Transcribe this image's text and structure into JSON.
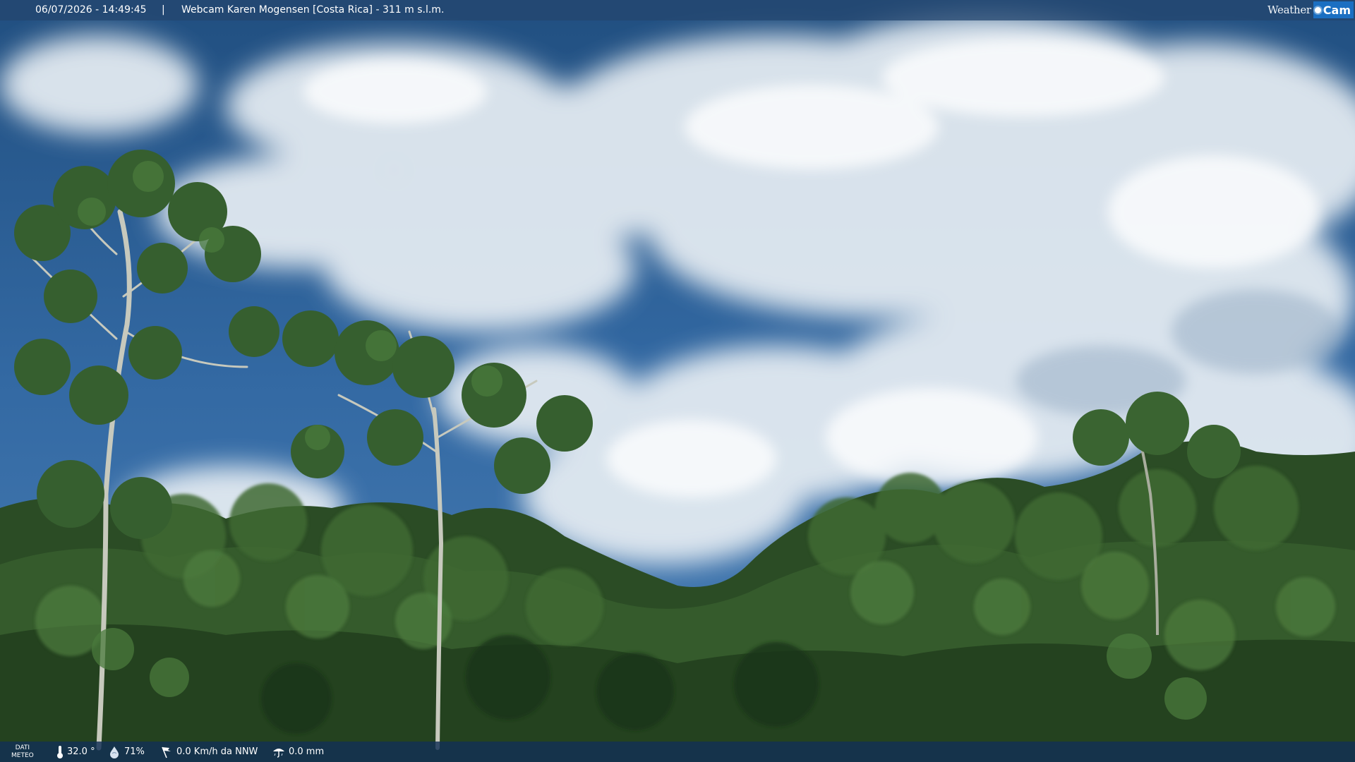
{
  "top_bar": {
    "timestamp": "06/07/2026 - 14:49:45",
    "separator": "|",
    "camera_label": "Webcam Karen Mogensen [Costa Rica]  - 311 m s.l.m."
  },
  "logo": {
    "weather": "Weather",
    "cam": "Cam"
  },
  "bottom_bar": {
    "dati_line1": "DATI",
    "dati_line2": "METEO",
    "temperature": "32.0 °",
    "humidity": "71%",
    "wind": "0.0 Km/h da NNW",
    "rain": "0.0 mm"
  },
  "icons": {
    "temperature": "thermometer-icon",
    "humidity": "humidity-drop-icon",
    "wind": "wind-flag-icon",
    "rain": "rain-umbrella-icon",
    "logo_sun": "sun-icon"
  },
  "colors": {
    "bar_top": "#244670",
    "bar_bottom": "#123056",
    "logo_cam_bg": "#1b6fc2",
    "sky_top": "#2a5c8f",
    "sky_bottom": "#3c73ab",
    "forest_dark": "#1d3a1a",
    "forest_light": "#3f6c31"
  }
}
